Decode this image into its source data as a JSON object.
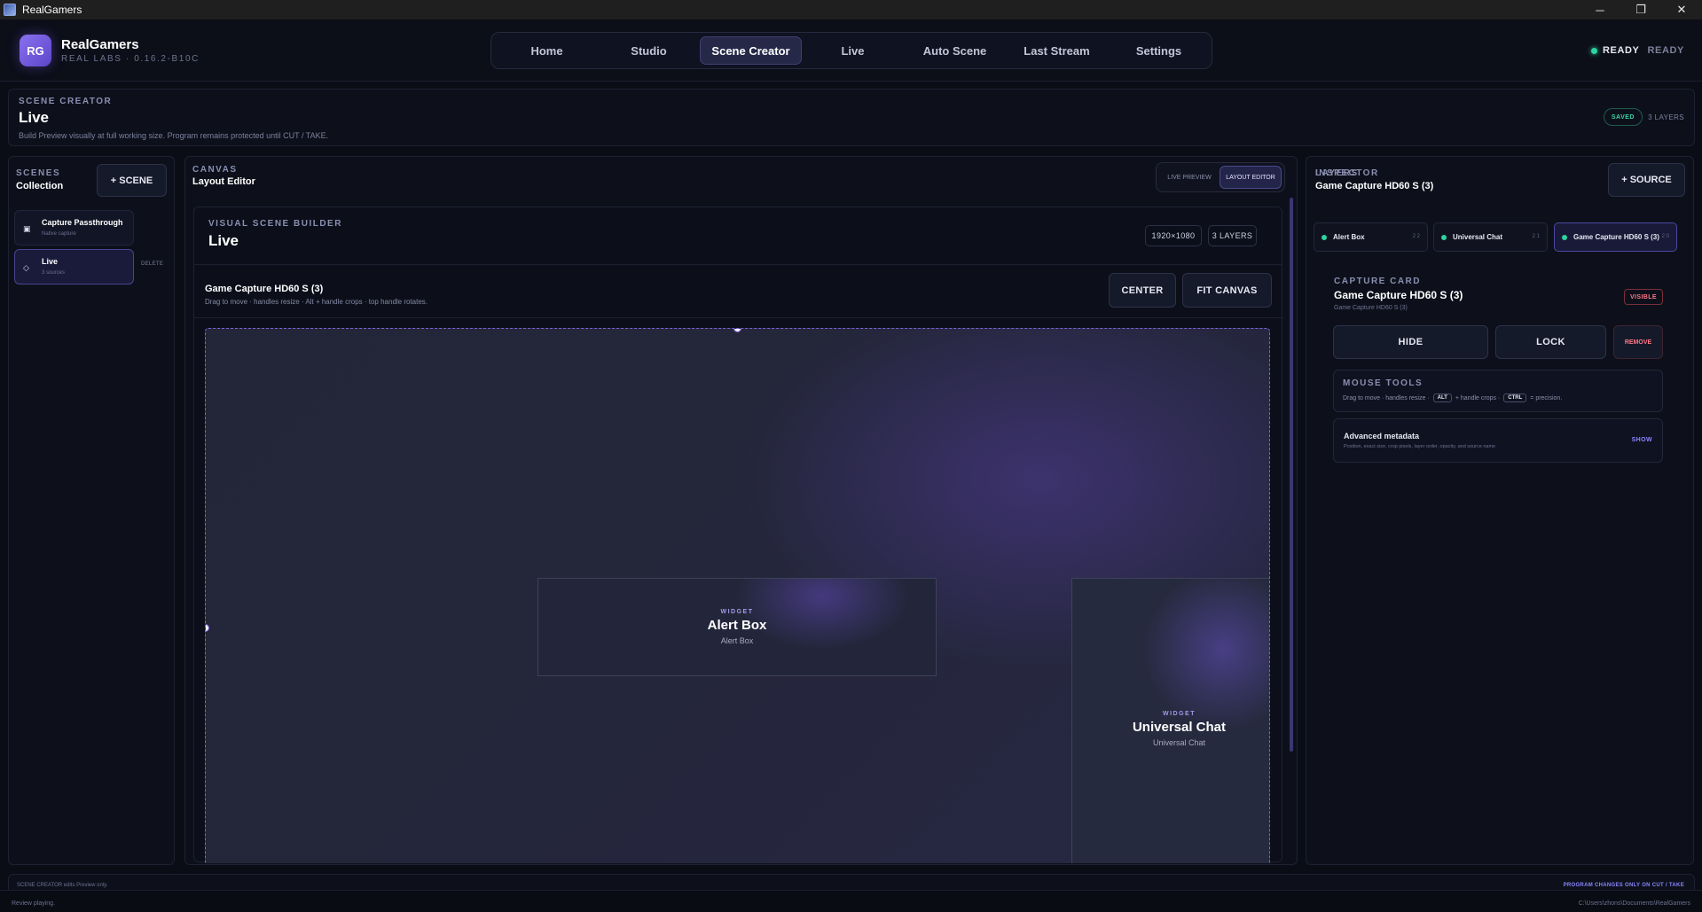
{
  "window": {
    "title": "RealGamers",
    "controls": [
      "─",
      "❐",
      "✕"
    ]
  },
  "brand": {
    "initials": "RG",
    "name": "RealGamers",
    "subtitle": "REAL LABS · 0.16.2-B10C"
  },
  "nav": {
    "tabs": [
      "Home",
      "Studio",
      "Scene Creator",
      "Live",
      "Auto Scene",
      "Last Stream",
      "Settings"
    ],
    "active": "Scene Creator"
  },
  "status": {
    "label": "READY",
    "state": "READY",
    "color": "#2ed3a0"
  },
  "page": {
    "eyebrow": "SCENE CREATOR",
    "title": "Live",
    "description": "Build Preview visually at full working size. Program remains protected until CUT / TAKE.",
    "saved_badge": "SAVED",
    "layers_count": "3 LAYERS"
  },
  "scenes": {
    "eyebrow": "SCENES",
    "subtitle": "Collection",
    "add_label": "+ SCENE",
    "delete_label": "DELETE",
    "items": [
      {
        "name": "Capture Passthrough",
        "meta": "Native capture",
        "icon": "▣"
      },
      {
        "name": "Live",
        "meta": "3 sources",
        "icon": "◇"
      }
    ]
  },
  "canvas": {
    "eyebrow": "CANVAS",
    "subtitle": "Layout Editor",
    "modes": [
      "LIVE PREVIEW",
      "LAYOUT EDITOR"
    ],
    "active_mode": "LAYOUT EDITOR",
    "builder": {
      "eyebrow": "VISUAL SCENE BUILDER",
      "title": "Live",
      "resolution": "1920×1080",
      "layers": "3 LAYERS",
      "selected_source": "Game Capture HD60 S (3)",
      "hint": "Drag to move · handles resize · Alt + handle crops · top handle rotates.",
      "center_label": "CENTER",
      "fit_label": "FIT CANVAS",
      "widgets": [
        {
          "label": "WIDGET",
          "name": "Alert Box",
          "sub": "Alert Box"
        },
        {
          "label": "WIDGET",
          "name": "Universal Chat",
          "sub": "Universal Chat"
        }
      ]
    }
  },
  "inspector": {
    "eyebrow": "INSPECTOR",
    "subtitle": "Game Capture HD60 S (3)",
    "add_source_label": "+ SOURCE",
    "layers_label": "LAYERS",
    "layers": [
      {
        "name": "Alert Box",
        "order": "2 2"
      },
      {
        "name": "Universal Chat",
        "order": "2 1"
      },
      {
        "name": "Game Capture HD60 S (3)",
        "order": "2 0"
      }
    ],
    "active_layer": "Game Capture HD60 S (3)",
    "card": {
      "eyebrow": "CAPTURE CARD",
      "name": "Game Capture HD60 S (3)",
      "sub": "Game Capture HD60 S (3)",
      "visible_badge": "VISIBLE",
      "hide_label": "HIDE",
      "lock_label": "LOCK",
      "remove_label": "REMOVE"
    },
    "mouse_tools": {
      "eyebrow": "MOUSE TOOLS",
      "text_a": "Drag to move · handles resize ·",
      "key_alt": "ALT",
      "text_b": "+ handle crops ·",
      "key_ctrl": "CTRL",
      "text_c": "= precision."
    },
    "advanced": {
      "title": "Advanced metadata",
      "description": "Position, exact size, crop pixels, layer order, opacity, and source name",
      "show_label": "SHOW"
    }
  },
  "footer": {
    "left": "SCENE CREATOR edits Preview only.",
    "right": "PROGRAM CHANGES ONLY ON CUT / TAKE"
  },
  "statusbar": {
    "left": "Review playing.",
    "right": "C:\\Users\\zhons\\Documents\\RealGamers"
  }
}
